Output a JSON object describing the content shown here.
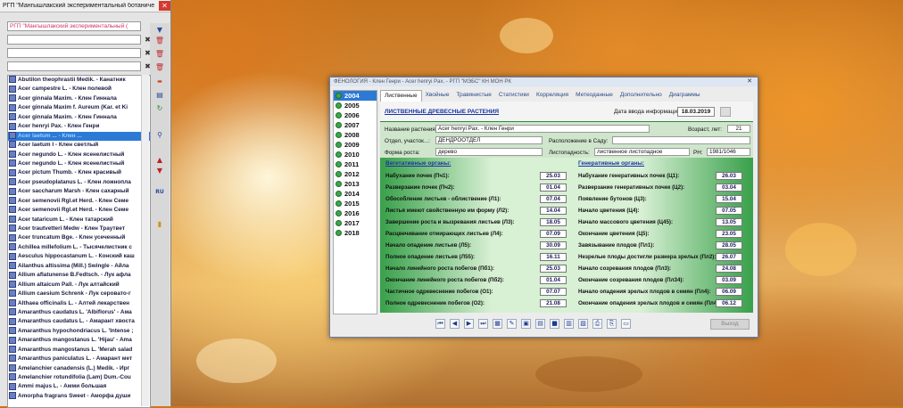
{
  "left_panel": {
    "window_title": "РГП \"Мангышлакский экспериментальный ботаниче",
    "filter_text": "РГП \"Мангышлакский экспериментальный (",
    "species": [
      "Abutilon theophrastii Medik. - Канатник",
      "Acer campestre L. - Клен полевой",
      "Acer ginnala Maxim. - Клен Гиннала",
      "Acer ginnala Maxim f. Aureum (Kar. et Ki",
      "Acer ginnala Maxim. - Клен Гиннала",
      "Acer henryi Pax. - Клен Генри",
      "Acer laetum ... - Клен ...",
      "Acer laetum I - Клен светлый",
      "Acer negundo L. - Клен ясенелистный",
      "Acer negundo L. - Клен ясенелистный",
      "Acer pictum Thumb. - Клен красивый",
      "Acer pseudoplatanus L. - Клен ложноплa",
      "Acer saccharum Marsh - Клен сахарный",
      "Acer semenovii Rgl.et Herd. - Клен Семе",
      "Acer semenovii Rgl.et Herd. - Клен Семе",
      "Acer tataricum L. - Клен татарский",
      "Acer trautvetteri Medw - Клен Траутвет",
      "Acer truncatum Bge. - Клен усеченный",
      "Achillea millefolium L. - Тысячелистник с",
      "Aesculus hippocastanum L. - Конский каш",
      "Ailanthus altissima (Mill.) Swingle - Айла",
      "Allium aflatunense B.Fedtsch. - Лук афла",
      "Allium altaicum Pall. - Лук алтайский",
      "Allium caesium Schrenk - Лук серовато-г",
      "Althaea officinalis L. - Алтей лекарствен",
      "Amaranthus caudatus L. 'Albiflorus' - Ама",
      "Amaranthus caudatus L. - Амарант хвоста",
      "Amaranthus hypochondriacus L. 'Intense ;",
      "Amaranthus mangostanus L. 'Hijau' - Ama",
      "Amaranthus mangostanus L. 'Merah salad",
      "Amaranthus paniculatus L. - Амарант мет",
      "Amelanchier canadensis (L.) Medik. - Ирг",
      "Amelanchier rotundifolia (Lam) Dum.-Cou",
      "Ammi majus L. - Амми большая",
      "Amorpha fragrans Sweet - Аморфа души"
    ],
    "selected_index": 6
  },
  "dialog": {
    "title": "ФЕНОЛОГИЯ - Клен Генри - Acer henryi Pax. - РГП \"МЭБС\" КН МОН РК",
    "years": [
      "2004",
      "2005",
      "2006",
      "2007",
      "2008",
      "2009",
      "2010",
      "2011",
      "2012",
      "2013",
      "2014",
      "2015",
      "2016",
      "2017",
      "2018"
    ],
    "selected_year": "2004",
    "tabs": [
      "Лиственные",
      "Хвойные",
      "Травянистые",
      "Статистики",
      "Корреляция",
      "Метеоданные",
      "Дополнительно",
      "Диаграммы"
    ],
    "section_title": "ЛИСТВЕННЫЕ ДРЕВЕСНЫЕ РАСТЕНИЯ",
    "date_label": "Дата ввода информации:",
    "date_value": "18.03.2019",
    "info": {
      "name_label": "Название растения:",
      "name_value": "Acer henryi Pax. - Клен Генри",
      "age_label": "Возраст, лет:",
      "age_value": "21",
      "dept_label": "Отдел, участок...:",
      "dept_value": "ДЕНДРООТДЕЛ",
      "location_label": "Расположение в Саду:",
      "location_value": "",
      "form_label": "Форма роста:",
      "form_value": "дерево",
      "leaf_label": "Листопадность:",
      "leaf_value": "лиственное листопадное",
      "rn_label": "РН:",
      "rn_value": "1981/1046"
    },
    "vegetative_title": "Вегетативные органы:",
    "generative_title": "Генеративные органы:",
    "vegetative": [
      {
        "label": "Набухание почек (Пч1):",
        "value": "25.03"
      },
      {
        "label": "Разверзание почек (Пч2):",
        "value": "01.04"
      },
      {
        "label": "Обособление листьев - облиствение (Л1):",
        "value": "07.04"
      },
      {
        "label": "Листья имеют свойственную им форму (Л2):",
        "value": "14.04"
      },
      {
        "label": "Завершение роста и вызревания листьев (Л3):",
        "value": "18.05"
      },
      {
        "label": "Расцвечивание отмирающих листьев (Л4):",
        "value": "07.09"
      },
      {
        "label": "Начало опадение листьев (Л5):",
        "value": "30.09"
      },
      {
        "label": "Полное опадение листьев (Л55):",
        "value": "16.11"
      },
      {
        "label": "Начало линейного роста побегов (Пб1):",
        "value": "25.03"
      },
      {
        "label": "Окончание линейного роста побегов (Пб2):",
        "value": "01.04"
      },
      {
        "label": "Частичное одревеснение побегов (О1):",
        "value": "07.07"
      },
      {
        "label": "Полное одревеснение побегов (О2):",
        "value": "21.08"
      }
    ],
    "generative": [
      {
        "label": "Набухание генеративных почек (Ц1):",
        "value": "26.03"
      },
      {
        "label": "Разверзание генеративных почек (Ц2):",
        "value": "03.04"
      },
      {
        "label": "Появление бутонов (Ц3):",
        "value": "15.04"
      },
      {
        "label": "Начало цветения (Ц4):",
        "value": "07.05"
      },
      {
        "label": "Начало массового цветения (Ц45):",
        "value": "13.05"
      },
      {
        "label": "Окончание цветения (Ц5):",
        "value": "23.05"
      },
      {
        "label": "Завязывание плодов (Пл1):",
        "value": "28.05"
      },
      {
        "label": "Незрелые плоды достигли размера зрелых (Пл2):",
        "value": "26.07"
      },
      {
        "label": "Начало созревания плодов (Пл3):",
        "value": "24.08"
      },
      {
        "label": "Окончание созревания плодов (Пл34):",
        "value": "03.09"
      },
      {
        "label": "Начало опадения зрелых плодов в семян (Пл4):",
        "value": "06.09"
      },
      {
        "label": "Окончание опадения зрелых плодов и семян (Пл45):",
        "value": "06.12"
      }
    ],
    "nav_icons": [
      "first-icon",
      "prev-icon",
      "next-icon",
      "last-icon",
      "grid-icon",
      "edit-icon",
      "new-icon",
      "table-icon",
      "green-icon",
      "chart-icon",
      "doc-icon",
      "print-icon",
      "save-icon",
      "folder-icon"
    ],
    "nav_glyphs": [
      "⏮",
      "◀",
      "▶",
      "⏭",
      "▦",
      "✎",
      "▣",
      "▤",
      "■",
      "▥",
      "▧",
      "⎙",
      "⎘",
      "▭"
    ],
    "ok_label": "Выход"
  }
}
